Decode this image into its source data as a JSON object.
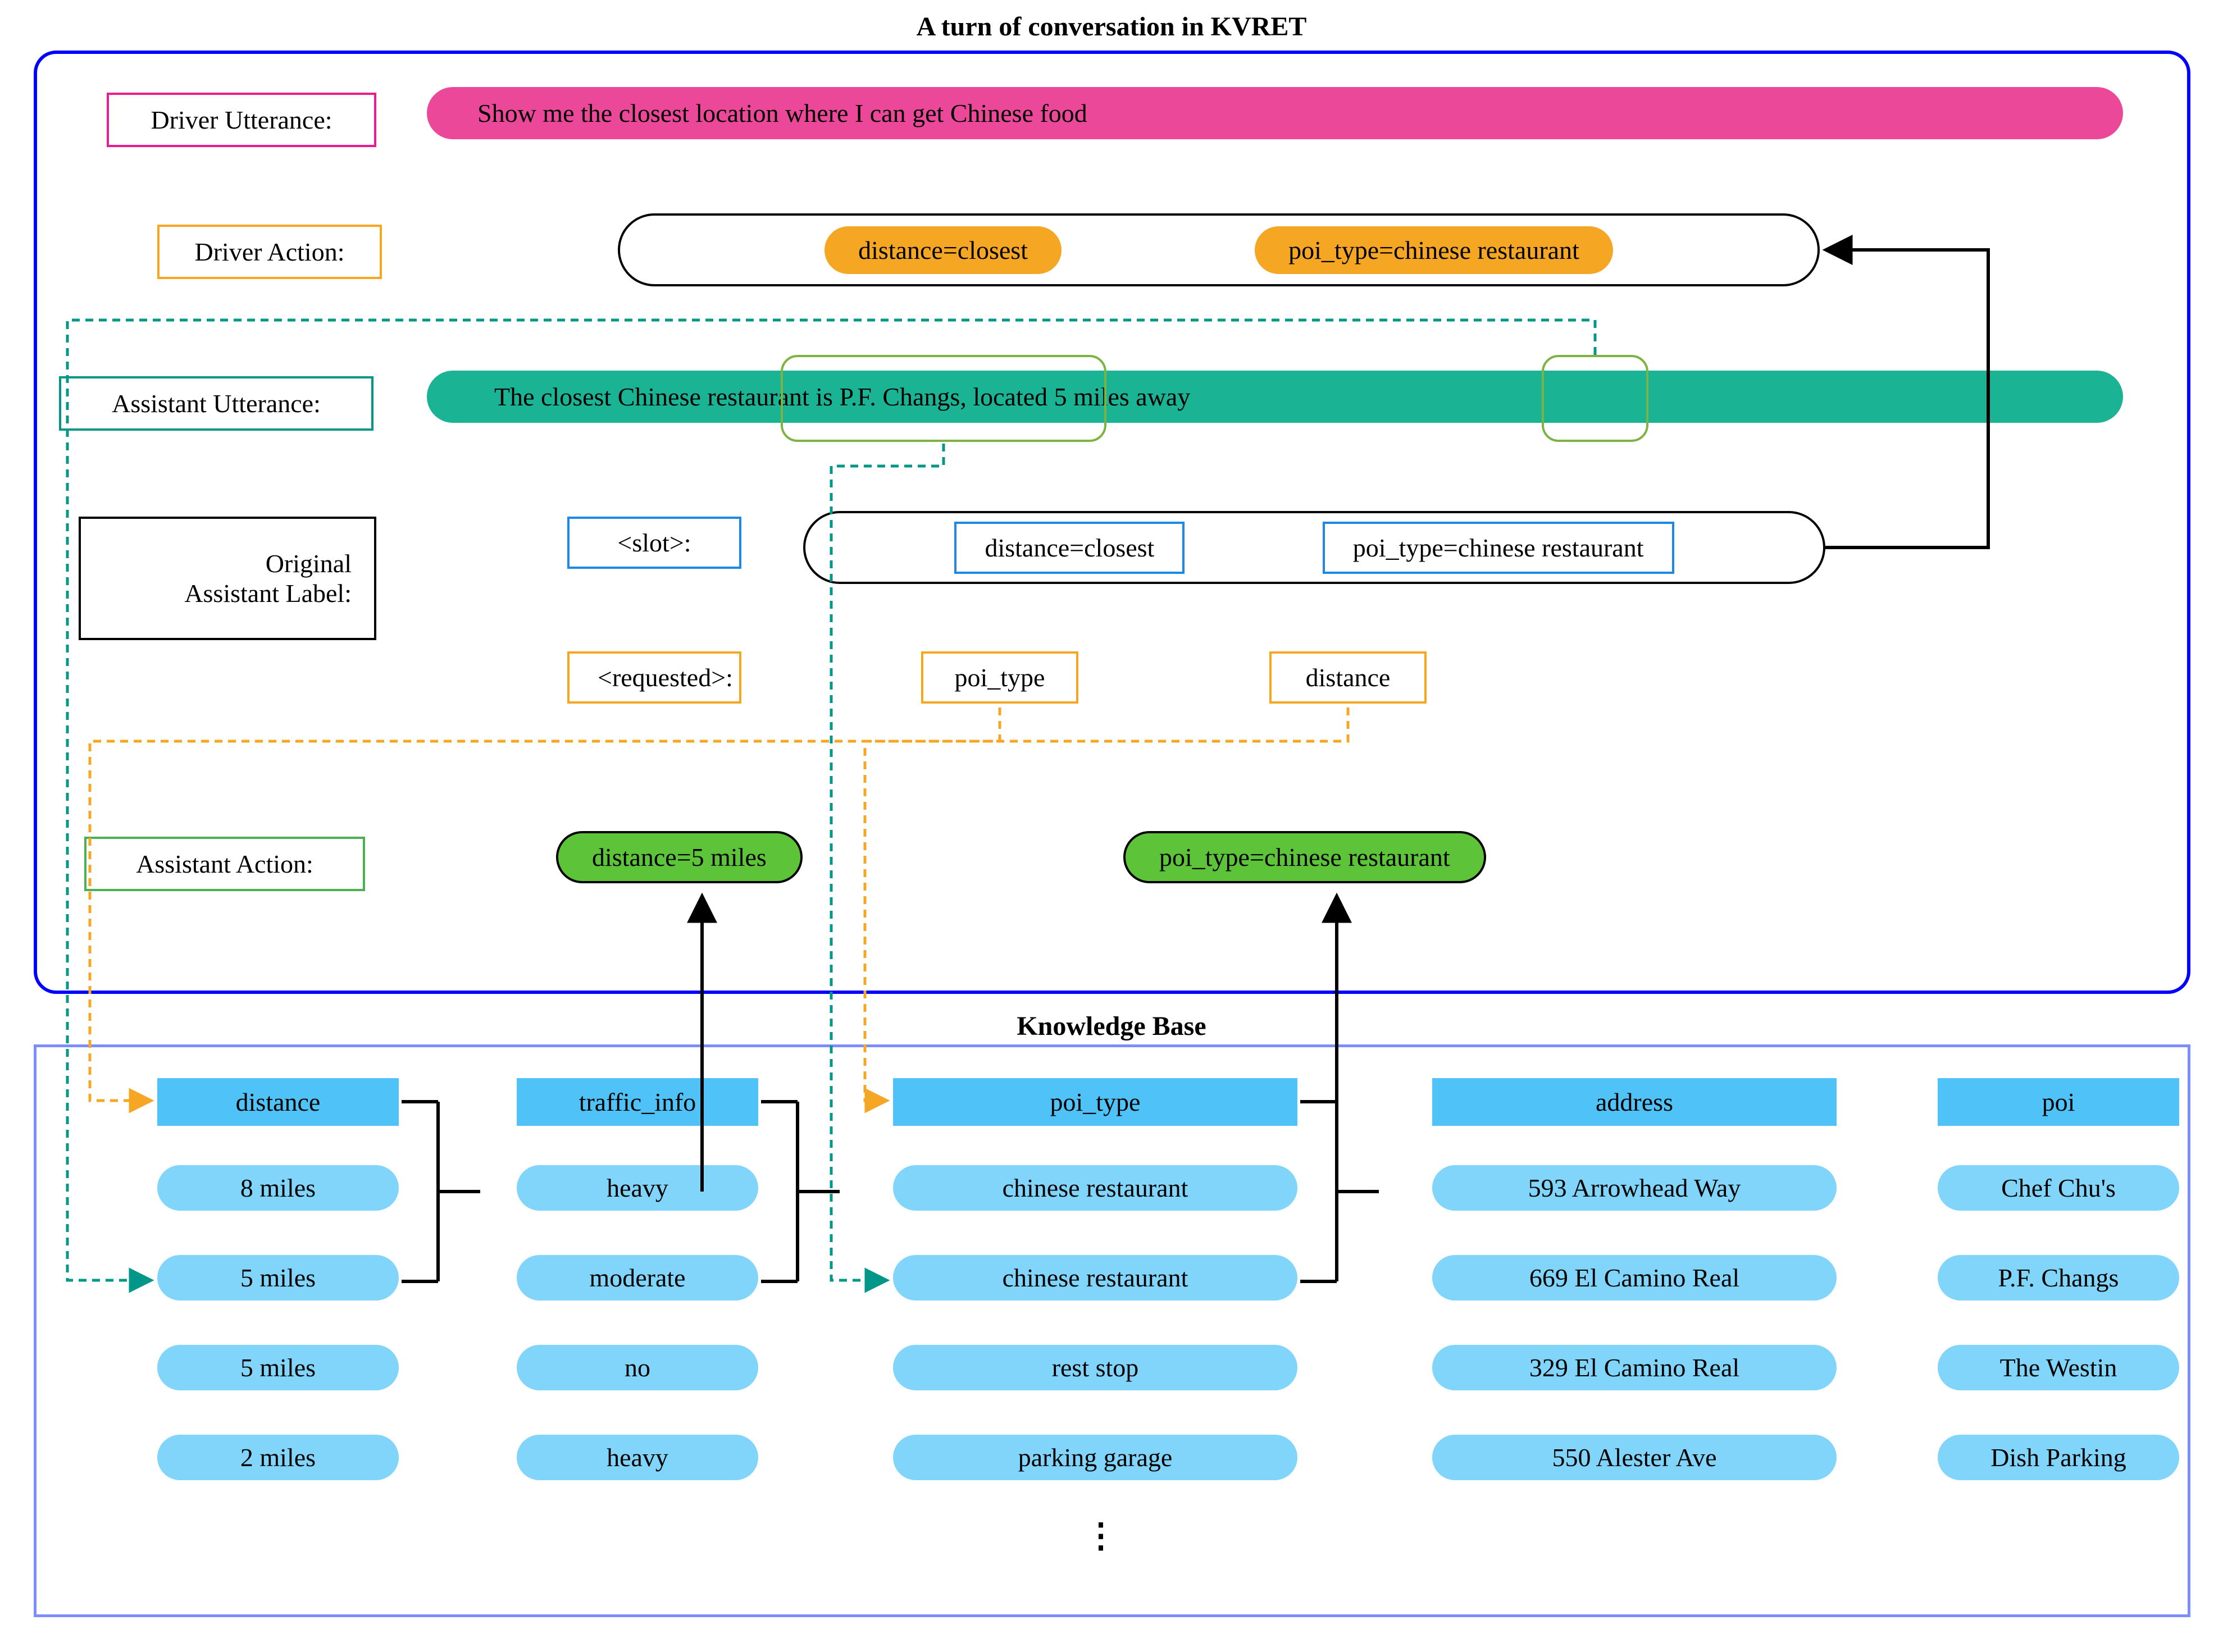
{
  "title": "A turn of conversation in KVRET",
  "driver_utterance_label": "Driver Utterance:",
  "driver_utterance": "Show me the closest location where I can get Chinese food",
  "driver_action_label": "Driver Action:",
  "driver_action": {
    "slot1": "distance=closest",
    "slot2": "poi_type=chinese restaurant"
  },
  "assistant_utterance_label": "Assistant Utterance:",
  "assistant_utterance": "The closest Chinese restaurant is P.F. Changs, located 5 miles away",
  "original_label_line1": "Original",
  "original_label_line2": "Assistant Label:",
  "slot_label": "<slot>:",
  "slot1": "distance=closest",
  "slot2": "poi_type=chinese restaurant",
  "req_label": "<requested>:",
  "req1": "poi_type",
  "req2": "distance",
  "assistant_action_label": "Assistant Action:",
  "aa1": "distance=5 miles",
  "aa2": "poi_type=chinese restaurant",
  "kb_title": "Knowledge Base",
  "kb": {
    "headers": [
      "distance",
      "traffic_info",
      "poi_type",
      "address",
      "poi"
    ],
    "rows": [
      [
        "8 miles",
        "heavy",
        "chinese restaurant",
        "593 Arrowhead Way",
        "Chef Chu's"
      ],
      [
        "5 miles",
        "moderate",
        "chinese restaurant",
        "669 El Camino Real",
        "P.F. Changs"
      ],
      [
        "5 miles",
        "no",
        "rest stop",
        "329 El Camino Real",
        "The Westin"
      ],
      [
        "2 miles",
        "heavy",
        "parking garage",
        "550 Alester Ave",
        "Dish Parking"
      ]
    ]
  },
  "ellipsis": "⋮"
}
